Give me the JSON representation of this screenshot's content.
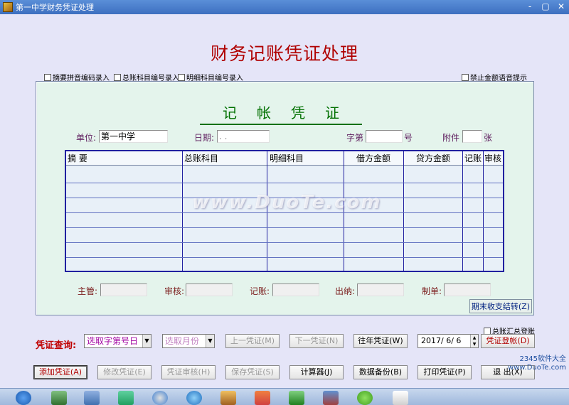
{
  "window": {
    "title": "第一中学财务凭证处理",
    "controls": [
      "-",
      "▢",
      "✕"
    ]
  },
  "main_title": "财务记账凭证处理",
  "options": {
    "pinyin": "摘要拼音编码录入",
    "general_code": "总账科目编号录入",
    "detail_code": "明细科目编号录入",
    "no_voice": "禁止金额语音提示"
  },
  "voucher": {
    "title": "记帐凭证",
    "unit_label": "单位:",
    "unit_value": "第一中学",
    "date_label": "日期:",
    "date_value": "  .  .",
    "zi_label": "字第",
    "hao_label": "号",
    "attach_label": "附件",
    "zhang_label": "张",
    "columns": [
      "摘      要",
      "总账科目",
      "明细科目",
      "借方金额",
      "贷方金额",
      "记账",
      "审核"
    ],
    "signers": [
      "主管:",
      "审核:",
      "记账:",
      "出纳:",
      "制单:"
    ],
    "period_close": "期末收支结转(Z)"
  },
  "query": {
    "label": "凭证查询:",
    "select_voucher": "选取字第号日",
    "select_month": "选取月份",
    "prev": "上一凭证(M)",
    "next": "下一凭证(N)",
    "past_year": "往年凭证(W)",
    "date": "2017/ 6/ 6",
    "register": "凭证登帐(D)",
    "summary_register": "总账汇总登账"
  },
  "actions": {
    "add": "添加凭证(A)",
    "modify": "修改凭证(E)",
    "audit": "凭证审核(H)",
    "save": "保存凭证(S)",
    "calc": "计算器(J)",
    "backup": "数据备份(B)",
    "print": "打印凭证(P)",
    "exit": "退  出(X)"
  },
  "watermark": "www.DuoTe.com",
  "corner_logo": [
    "2345软件大全",
    "www.DuoTe.com"
  ],
  "colors": {
    "title_red": "#b00000",
    "voucher_green": "#007000",
    "table_border": "#2020a0"
  }
}
